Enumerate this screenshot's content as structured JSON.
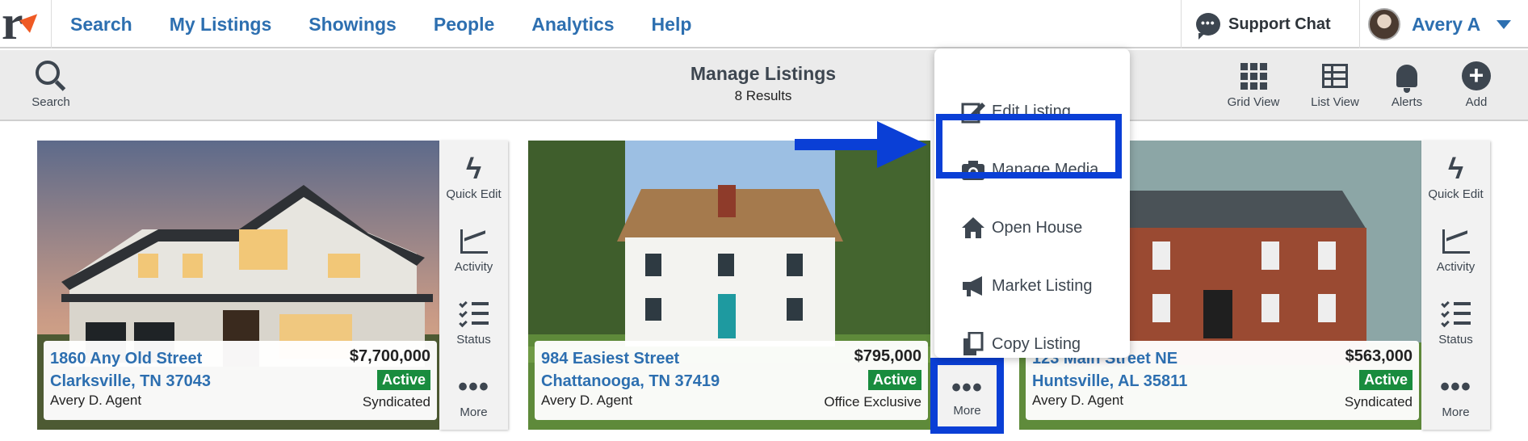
{
  "nav": {
    "links": [
      "Search",
      "My Listings",
      "Showings",
      "People",
      "Analytics",
      "Help"
    ],
    "support_label": "Support Chat",
    "support_icon": "chat-bubble-icon",
    "user_name": "Avery A"
  },
  "toolbar": {
    "search_label": "Search",
    "title": "Manage Listings",
    "results": "8 Results",
    "grid_label": "Grid View",
    "list_label": "List View",
    "alerts_label": "Alerts",
    "add_label": "Add"
  },
  "side_actions": {
    "quick_edit": "Quick Edit",
    "activity": "Activity",
    "status": "Status",
    "more": "More"
  },
  "listings": [
    {
      "addr1": "1860 Any Old Street",
      "addr2": "Clarksville, TN 37043",
      "agent": "Avery D. Agent",
      "price": "$7,700,000",
      "status": "Active",
      "type": "Syndicated"
    },
    {
      "addr1": "984 Easiest Street",
      "addr2": "Chattanooga, TN 37419",
      "agent": "Avery D. Agent",
      "price": "$795,000",
      "status": "Active",
      "type": "Office Exclusive"
    },
    {
      "addr1": "123 Main Street NE",
      "addr2": "Huntsville, AL 35811",
      "agent": "Avery D. Agent",
      "price": "$563,000",
      "status": "Active",
      "type": "Syndicated"
    }
  ],
  "menu": {
    "items": [
      "Edit Listing",
      "Manage Media",
      "Open House",
      "Market Listing",
      "Copy Listing"
    ],
    "highlighted": "Manage Media"
  },
  "colors": {
    "link": "#2d6fb0",
    "active_badge": "#198c3e",
    "highlight": "#0a3fd6",
    "logo_accent": "#ef5a24"
  }
}
